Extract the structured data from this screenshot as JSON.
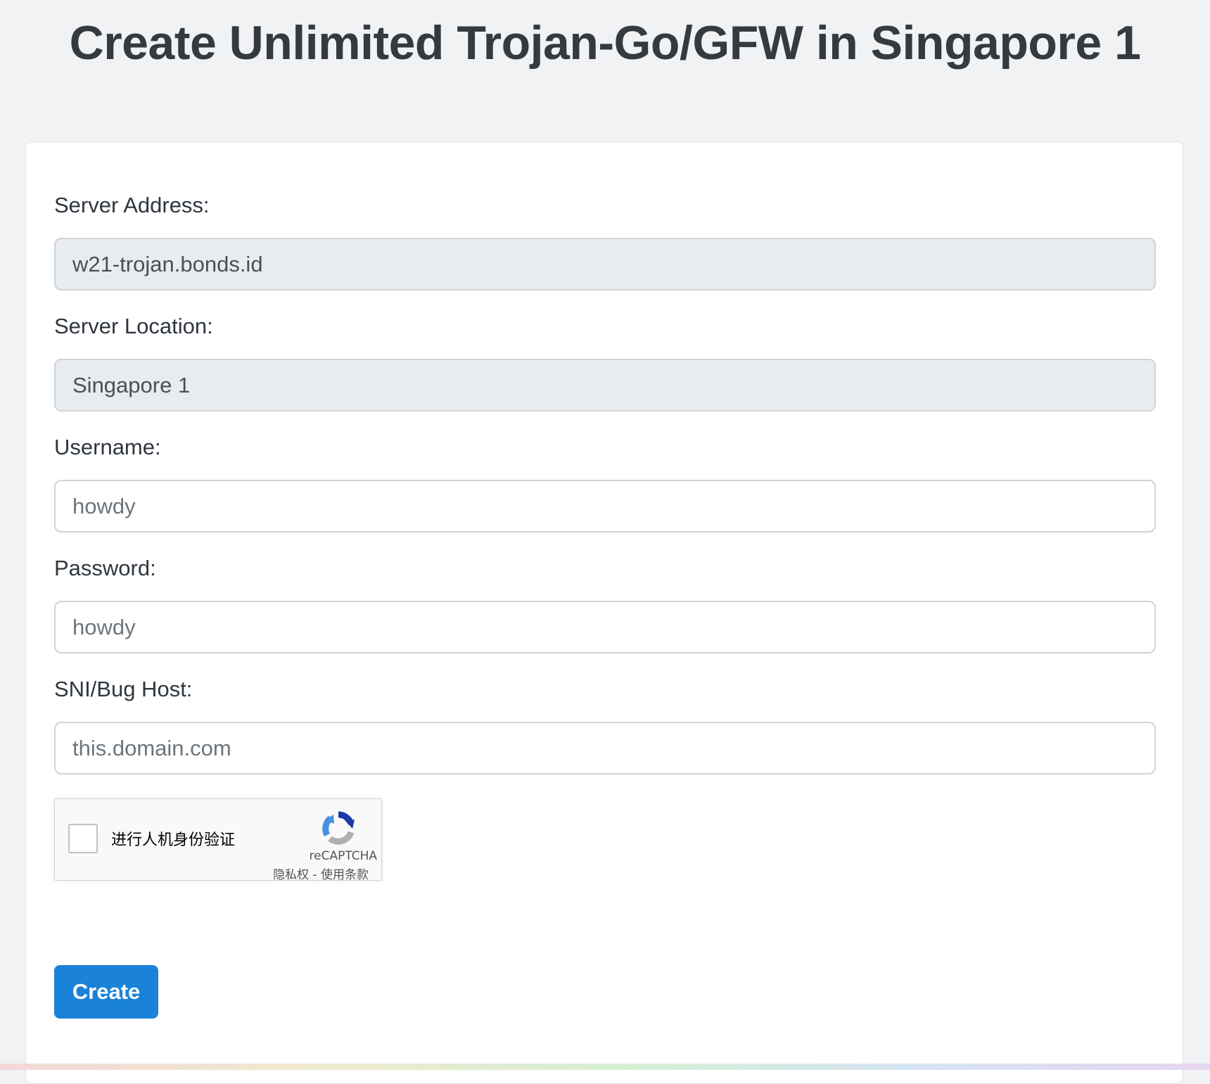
{
  "page": {
    "title": "Create Unlimited Trojan-Go/GFW in Singapore 1"
  },
  "form": {
    "server_address": {
      "label": "Server Address:",
      "value": "w21-trojan.bonds.id"
    },
    "server_location": {
      "label": "Server Location:",
      "value": "Singapore 1"
    },
    "username": {
      "label": "Username:",
      "value": "",
      "placeholder": "howdy"
    },
    "password": {
      "label": "Password:",
      "value": "",
      "placeholder": "howdy"
    },
    "sni_bug_host": {
      "label": "SNI/Bug Host:",
      "value": "",
      "placeholder": "this.domain.com"
    }
  },
  "recaptcha": {
    "checkbox_label": "进行人机身份验证",
    "brand": "reCAPTCHA",
    "privacy_link": "隐私权",
    "separator": " - ",
    "terms_link": "使用条款",
    "logo_icon": "recaptcha-logo-icon",
    "colors": {
      "logo_blue": "#1c3aa9",
      "logo_light_blue": "#4a90e2",
      "logo_gray": "#b0b0b0"
    }
  },
  "actions": {
    "create_label": "Create"
  },
  "colors": {
    "primary": "#1a82d9",
    "page_background": "#f1f2f4",
    "readonly_field": "#e9ecef"
  }
}
